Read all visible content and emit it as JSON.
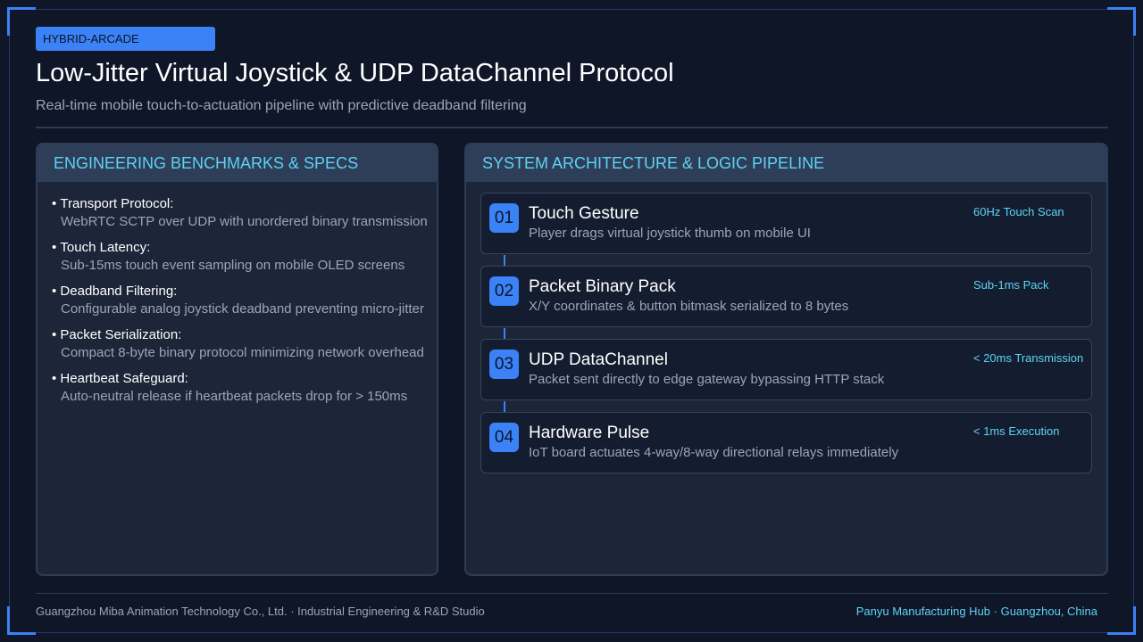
{
  "header": {
    "tag": "HYBRID-ARCADE",
    "title": "Low-Jitter Virtual Joystick & UDP DataChannel Protocol",
    "subtitle": "Real-time mobile touch-to-actuation pipeline with predictive deadband filtering"
  },
  "specs": {
    "heading": "ENGINEERING BENCHMARKS & SPECS",
    "items": [
      {
        "label": "Transport Protocol:",
        "value": "WebRTC SCTP over UDP with unordered binary transmission"
      },
      {
        "label": "Touch Latency:",
        "value": "Sub-15ms touch event sampling on mobile OLED screens"
      },
      {
        "label": "Deadband Filtering:",
        "value": "Configurable analog joystick deadband preventing micro-jitter"
      },
      {
        "label": "Packet Serialization:",
        "value": "Compact 8-byte binary protocol minimizing network overhead"
      },
      {
        "label": "Heartbeat Safeguard:",
        "value": "Auto-neutral release if heartbeat packets drop for > 150ms"
      }
    ]
  },
  "pipeline": {
    "heading": "SYSTEM ARCHITECTURE & LOGIC PIPELINE",
    "steps": [
      {
        "num": "01",
        "title": "Touch Gesture",
        "desc": "Player drags virtual joystick thumb on mobile UI",
        "metric": "60Hz Touch Scan"
      },
      {
        "num": "02",
        "title": "Packet Binary Pack",
        "desc": "X/Y coordinates & button bitmask serialized to 8 bytes",
        "metric": "Sub-1ms Pack"
      },
      {
        "num": "03",
        "title": "UDP DataChannel",
        "desc": "Packet sent directly to edge gateway bypassing HTTP stack",
        "metric": "< 20ms Transmission"
      },
      {
        "num": "04",
        "title": "Hardware Pulse",
        "desc": "IoT board actuates 4-way/8-way directional relays immediately",
        "metric": "< 1ms Execution"
      }
    ]
  },
  "footer": {
    "left": "Guangzhou Miba Animation Technology Co., Ltd. · Industrial Engineering & R&D Studio",
    "right": "Panyu Manufacturing Hub · Guangzhou, China"
  },
  "colors": {
    "background": "#0e1628",
    "accent": "#3b82f6",
    "highlight": "#5ed3f3",
    "panel": "#1c2638"
  }
}
